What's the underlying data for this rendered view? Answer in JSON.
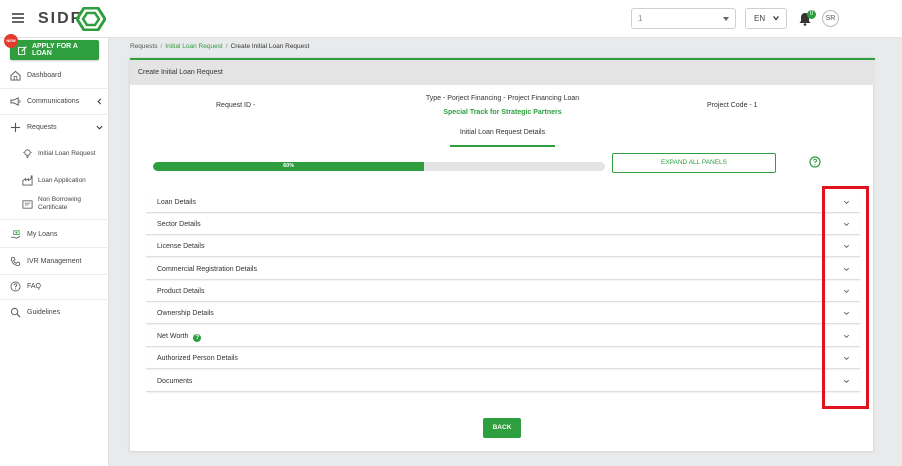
{
  "header": {
    "logo_text": "SIDF",
    "top_select_value": "1",
    "language": "EN",
    "notification_count": "0",
    "avatar_initials": "SR"
  },
  "sidebar": {
    "apply_button": "APPLY FOR A LOAN",
    "new_badge": "NEW",
    "items": [
      {
        "label": "Dashboard",
        "icon": "dashboard-icon"
      },
      {
        "label": "Communications",
        "icon": "megaphone-icon"
      },
      {
        "label": "Requests",
        "icon": "plus-icon"
      },
      {
        "label": "My Loans",
        "icon": "hand-money-icon"
      },
      {
        "label": "IVR Management",
        "icon": "phone-icon"
      },
      {
        "label": "FAQ",
        "icon": "question-icon"
      },
      {
        "label": "Guidelines",
        "icon": "search-icon"
      }
    ],
    "subitems": [
      {
        "label": "Initial Loan Request",
        "icon": "lightbulb-icon"
      },
      {
        "label": "Loan Application",
        "icon": "factory-icon"
      },
      {
        "label": "Non Borrowing Certificate",
        "icon": "certificate-icon"
      }
    ]
  },
  "breadcrumb": {
    "root": "Requests",
    "parent": "Initial Loan Request",
    "current": "Create Initial Loan Request",
    "separator": "/"
  },
  "card": {
    "title": "Create Initial Loan Request",
    "request_id": "Request ID -",
    "type": "Type - Porject Financing - Project Financing Loan",
    "track": "Special Track for Strategic Partners",
    "project_code": "Project Code - 1",
    "tab": "Initial Loan Request Details",
    "progress_percent": 60,
    "progress_label": "60%",
    "expand_button": "EXPAND ALL PANELS",
    "panels": [
      {
        "label": "Loan Details"
      },
      {
        "label": "Sector Details"
      },
      {
        "label": "License Details"
      },
      {
        "label": "Commercial Registration Details"
      },
      {
        "label": "Product Details"
      },
      {
        "label": "Ownership Details"
      },
      {
        "label": "Net Worth",
        "help": "?"
      },
      {
        "label": "Authorized Person Details"
      },
      {
        "label": "Documents"
      }
    ],
    "back_button": "BACK"
  },
  "colors": {
    "accent": "#2e9e3e",
    "highlight": "#e0121d"
  }
}
